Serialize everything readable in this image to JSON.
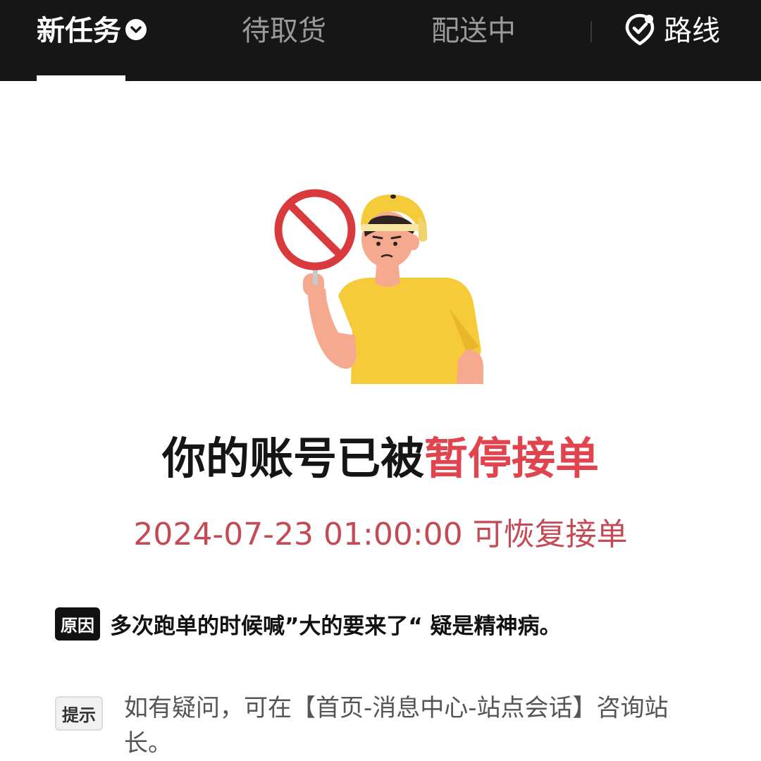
{
  "tabs": {
    "new_task": "新任务",
    "pending_pickup": "待取货",
    "delivering": "配送中",
    "route": "路线"
  },
  "icons": {
    "dropdown": "chevron-down-icon",
    "route": "route-pin-icon",
    "prohibited": "prohibited-sign-icon"
  },
  "status": {
    "headline_prefix": "你的账号已被",
    "headline_highlight": "暂停接单",
    "resume_time": "2024-07-23 01:00:00 可恢复接单"
  },
  "reason": {
    "badge": "原因",
    "text": "多次跑单的时候喊”大的要来了“ 疑是精神病。"
  },
  "tip": {
    "badge": "提示",
    "text": "如有疑问，可在【首页-消息中心-站点会话】咨询站长。"
  },
  "colors": {
    "topbar": "#161616",
    "highlight_red": "#e0454f",
    "resume_red": "#c44a55",
    "shirt_yellow": "#f6cb3a",
    "sign_red": "#d93a3d"
  }
}
